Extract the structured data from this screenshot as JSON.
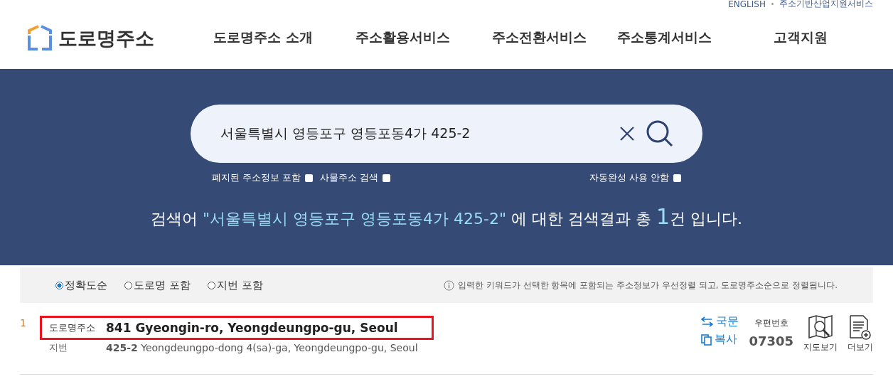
{
  "top_links": [
    "ENGLISH",
    "주소기반산업지원서비스"
  ],
  "logo": "도로명주소",
  "nav": [
    "도로명주소 소개",
    "주소활용서비스",
    "주소전환서비스",
    "주소통계서비스",
    "고객지원"
  ],
  "search": {
    "value": "서울특별시 영등포구 영등포동4가 425-2"
  },
  "options": [
    {
      "label": "폐지된 주소정보 포함",
      "checked": false
    },
    {
      "label": "사물주소 검색",
      "checked": false
    },
    {
      "label": "자동완성 사용 안함",
      "checked": false
    }
  ],
  "result_summary": {
    "prefix": "검색어",
    "query": "\"서울특별시 영등포구 영등포동4가 425-2\"",
    "middle": "에 대한 검색결과 총",
    "count": "1",
    "suffix": "건 입니다."
  },
  "sort": [
    {
      "label": "정확도순",
      "selected": true
    },
    {
      "label": "도로명 포함",
      "selected": false
    },
    {
      "label": "지번 포함",
      "selected": false
    }
  ],
  "sort_note": "입력한 키워드가 선택한 항목에 포함되는 주소정보가 우선정렬 되고, 도로명주소순으로 정렬됩니다.",
  "results": [
    {
      "index": "1",
      "road_label": "도로명주소",
      "road": "841 Gyeongin-ro, Yeongdeungpo-gu, Seoul",
      "highlighted": true,
      "jibun_label": "지번",
      "jibun": "**425-2** Yeongdeungpo-dong 4(sa)-ga, Yeongdeungpo-gu, Seoul",
      "korean": "국문",
      "copy": "복사",
      "zip_label": "우편번호",
      "zip": "07305",
      "map": "지도보기",
      "more": "더보기"
    }
  ]
}
